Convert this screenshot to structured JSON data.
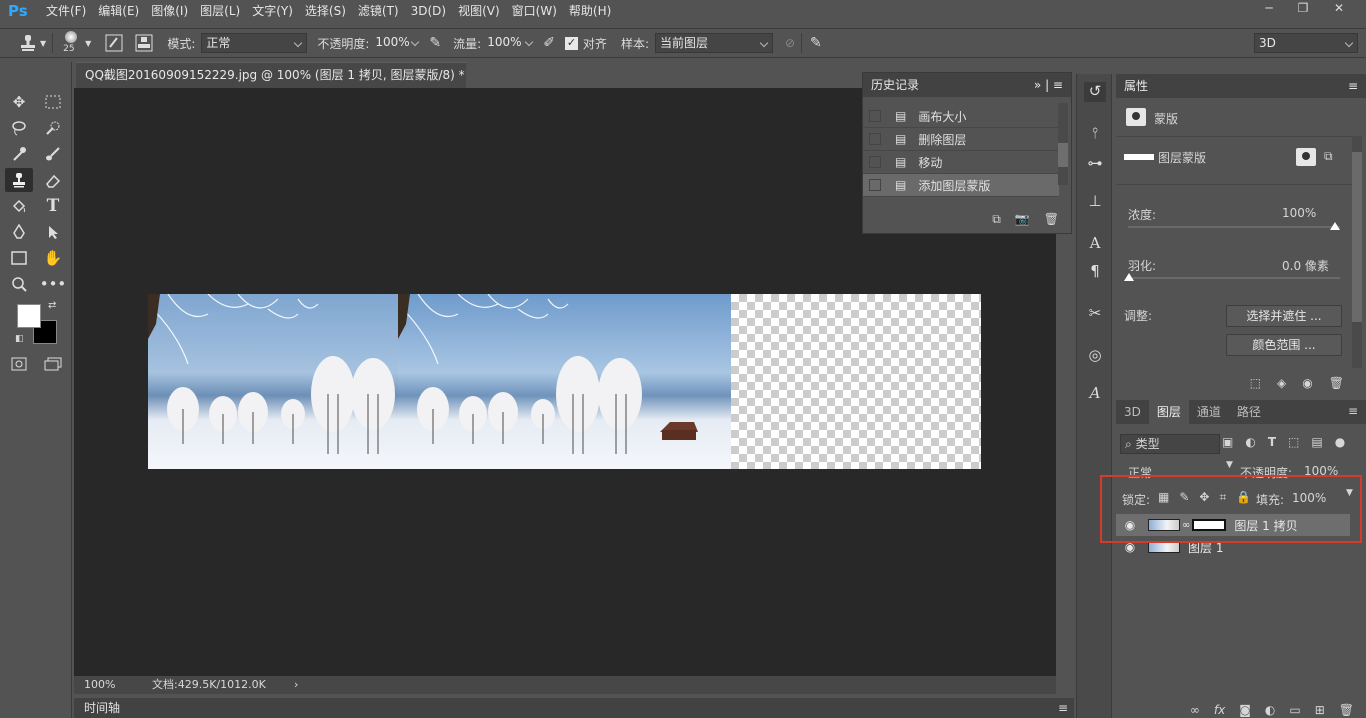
{
  "app": {
    "logo": "Ps"
  },
  "menu": [
    "文件(F)",
    "编辑(E)",
    "图像(I)",
    "图层(L)",
    "文字(Y)",
    "选择(S)",
    "滤镜(T)",
    "3D(D)",
    "视图(V)",
    "窗口(W)",
    "帮助(H)"
  ],
  "options": {
    "brush_size": "25",
    "mode_label": "模式:",
    "mode_value": "正常",
    "opacity_label": "不透明度:",
    "opacity_value": "100%",
    "flow_label": "流量:",
    "flow_value": "100%",
    "align_label": "对齐",
    "sample_label": "样本:",
    "sample_value": "当前图层",
    "workspace": "3D"
  },
  "document": {
    "tab_title": "QQ截图20160909152229.jpg @ 100% (图层 1 拷贝, 图层蒙版/8) *",
    "zoom": "100%",
    "doc_info": "文档:429.5K/1012.0K"
  },
  "history": {
    "title": "历史记录",
    "items": [
      "画布大小",
      "删除图层",
      "移动",
      "添加图层蒙版"
    ]
  },
  "properties": {
    "title": "属性",
    "section": "蒙版",
    "mask_label": "图层蒙版",
    "density_label": "浓度:",
    "density_value": "100%",
    "feather_label": "羽化:",
    "feather_value": "0.0 像素",
    "adjust_label": "调整:",
    "btn_select_mask": "选择并遮住 ...",
    "btn_color_range": "颜色范围 ..."
  },
  "layers_panel": {
    "tabs": [
      "3D",
      "图层",
      "通道",
      "路径"
    ],
    "filter_kind": "类型",
    "blend_mode": "正常",
    "opacity_label": "不透明度:",
    "opacity_value": "100%",
    "lock_label": "锁定:",
    "fill_label": "填充:",
    "fill_value": "100%",
    "layers": [
      {
        "name": "图层 1 拷贝",
        "selected": true,
        "has_mask": true
      },
      {
        "name": "图层 1",
        "selected": false,
        "has_mask": false
      }
    ]
  },
  "timeline": {
    "label": "时间轴"
  },
  "colors": {
    "highlight": "#d63a2c",
    "accent": "#31a8ff"
  }
}
